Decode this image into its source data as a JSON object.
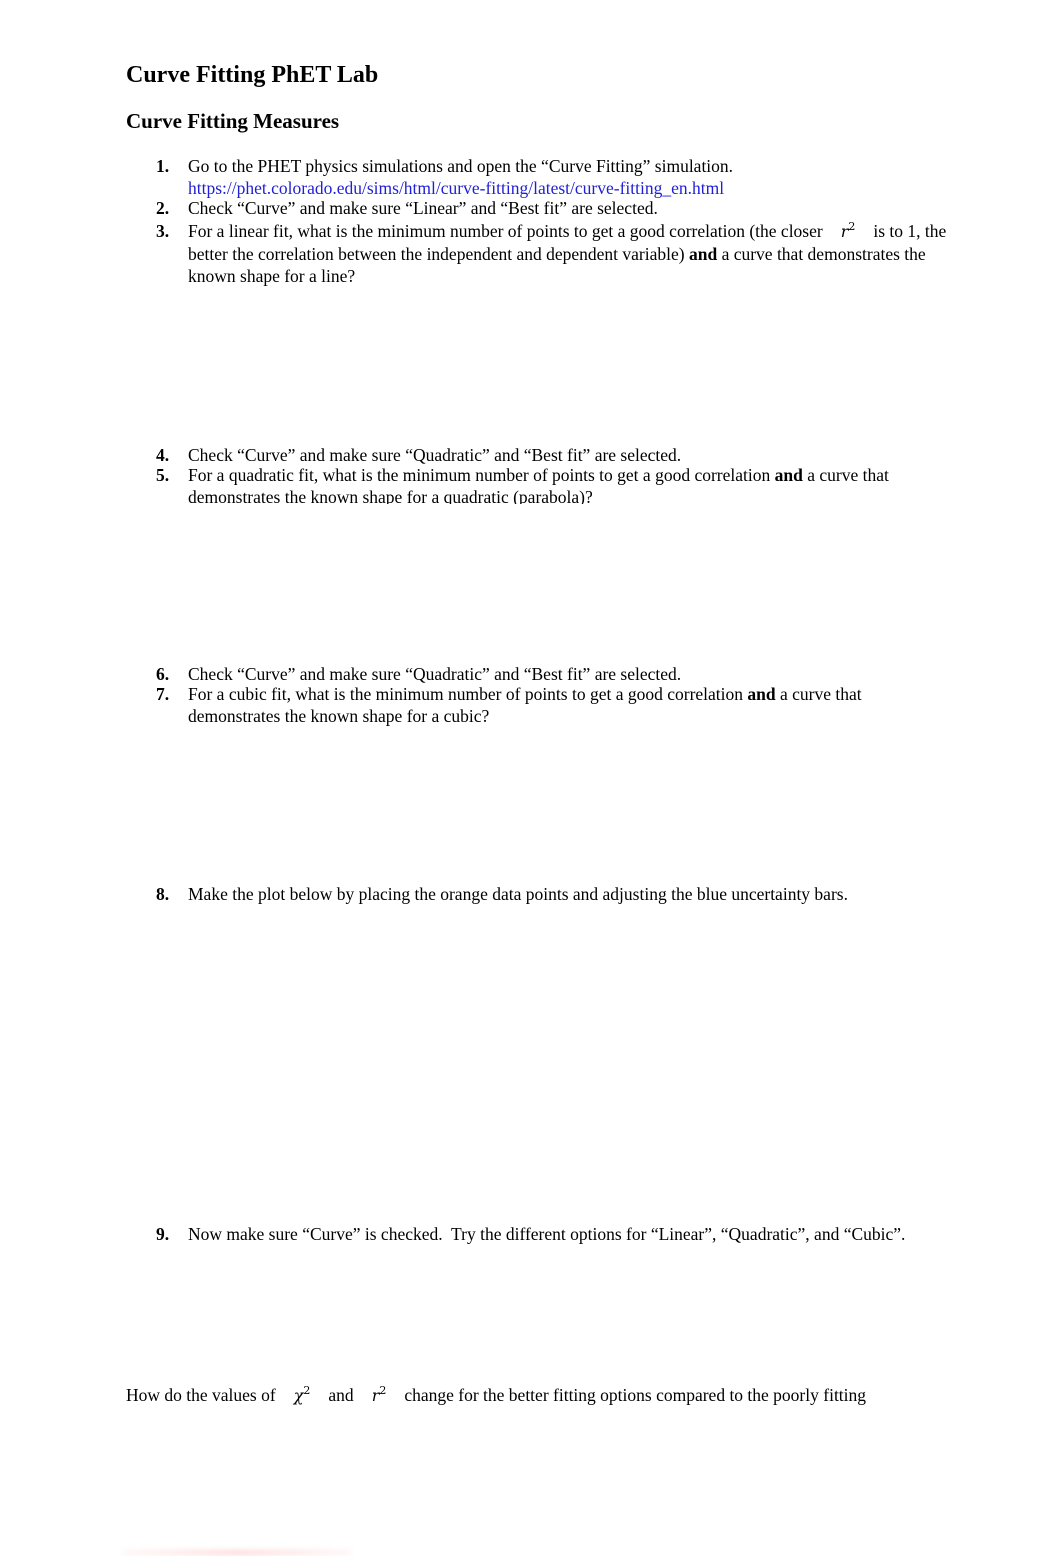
{
  "document": {
    "title": "Curve Fitting PhET Lab",
    "section_heading": "Curve Fitting Measures"
  },
  "items": [
    {
      "number": "1.",
      "text": "Go to the PHET physics simulations and open the “Curve Fitting” simulation.",
      "link": "https://phet.colorado.edu/sims/html/curve-fitting/latest/curve-fitting_en.html"
    },
    {
      "number": "2.",
      "text": "Check “Curve” and make sure “Linear” and “Best fit” are selected."
    },
    {
      "number": "3.",
      "text_before_math": "For a linear fit, what is the minimum number of points to get a good correlation (the closer",
      "math": "r",
      "math_sup": "2",
      "text_after_math": "is to 1, the better the correlation between the independent and dependent variable)",
      "bold": "and",
      "text_end": "a curve that demonstrates the known shape for a line?"
    },
    {
      "number": "4.",
      "text": "Check “Curve” and make sure “Quadratic” and “Best fit” are selected."
    },
    {
      "number": "5.",
      "text_before_bold": "For a quadratic fit, what is the minimum number of points to get a good correlation",
      "bold": "and",
      "text_after_bold": "a curve that demonstrates the known shape for a quadratic (parabola)?"
    },
    {
      "number": "6.",
      "text": "Check “Curve” and make sure “Quadratic” and “Best fit” are selected."
    },
    {
      "number": "7.",
      "text_before_bold": "For a cubic fit, what is the minimum number of points to get a good correlation",
      "bold": "and",
      "text_after_bold": "a curve that demonstrates the known shape for a cubic?"
    },
    {
      "number": "8.",
      "text": "Make the plot below by placing the orange data points and adjusting the blue uncertainty bars."
    },
    {
      "number": "9.",
      "text": "Now make sure “Curve” is checked.  Try the different options for “Linear”, “Quadratic”, and “Cubic”."
    }
  ],
  "closing_question": {
    "text_start": "How do the values of",
    "math1": "χ",
    "math1_sup": "2",
    "connector": "and",
    "math2": "r",
    "math2_sup": "2",
    "text_end": "change for the better fitting options compared to the poorly fitting"
  },
  "colors": {
    "link": "#1f1fd6",
    "text": "#000000"
  }
}
